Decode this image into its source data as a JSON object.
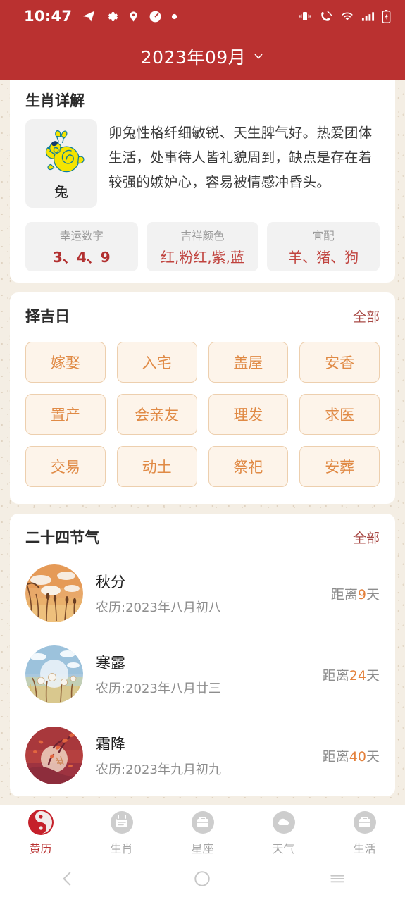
{
  "statusbar": {
    "time": "10:47",
    "left_icons": [
      "send-icon",
      "gear-icon",
      "location-pin-icon",
      "speedometer-icon",
      "dot-icon"
    ],
    "right_icons": [
      "vibrate-icon",
      "call-mute-icon",
      "wifi-icon",
      "signal-bars-icon",
      "battery-charging-icon"
    ]
  },
  "header": {
    "title": "2023年09月",
    "dropdown_icon": "chevron-down-icon",
    "background_color": "#ba3130"
  },
  "zodiac": {
    "section_title": "生肖详解",
    "animal_name": "兔",
    "animal_icon": "rabbit-icon",
    "description": "卯兔性格纤细敏锐、天生脾气好。热爱团体生活，处事待人皆礼貌周到，缺点是存在着较强的嫉妒心，容易被情感冲昏头。",
    "attributes": [
      {
        "label": "幸运数字",
        "value": "3、4、9",
        "style": "bold"
      },
      {
        "label": "吉祥颜色",
        "value": "红,粉红,紫,蓝",
        "style": "thin"
      },
      {
        "label": "宜配",
        "value": "羊、猪、狗",
        "style": "thin"
      }
    ]
  },
  "lucky_days": {
    "section_title": "择吉日",
    "more_label": "全部",
    "items": [
      "嫁娶",
      "入宅",
      "盖屋",
      "安香",
      "置产",
      "会亲友",
      "理发",
      "求医",
      "交易",
      "动土",
      "祭祀",
      "安葬"
    ]
  },
  "solar_terms": {
    "section_title": "二十四节气",
    "more_label": "全部",
    "distance_prefix": "距离",
    "distance_suffix": "天",
    "items": [
      {
        "name": "秋分",
        "lunar": "农历:2023年八月初八",
        "days": "9",
        "image": "autumn-wheat-field-icon"
      },
      {
        "name": "寒露",
        "lunar": "农历:2023年八月廿三",
        "days": "24",
        "image": "cold-dew-blue-scene-icon"
      },
      {
        "name": "霜降",
        "lunar": "农历:2023年九月初九",
        "days": "40",
        "image": "frost-descent-red-scene-icon"
      }
    ]
  },
  "tabbar": {
    "items": [
      {
        "label": "黄历",
        "icon": "yinyang-icon",
        "active": true
      },
      {
        "label": "生肖",
        "icon": "calendar-icon",
        "active": false
      },
      {
        "label": "星座",
        "icon": "briefcase-icon",
        "active": false
      },
      {
        "label": "天气",
        "icon": "cloud-icon",
        "active": false
      },
      {
        "label": "生活",
        "icon": "briefcase-icon",
        "active": false
      }
    ],
    "active_color": "#b9302f",
    "inactive_color": "#c9c9c9"
  },
  "system_nav": {
    "back_icon": "back-chevron-icon",
    "home_icon": "home-circle-icon",
    "recents_icon": "recents-lines-icon"
  }
}
